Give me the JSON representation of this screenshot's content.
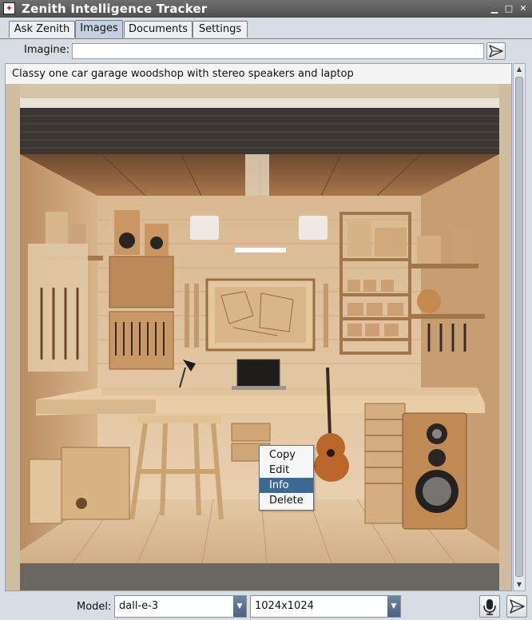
{
  "window": {
    "title": "Zenith Intelligence Tracker",
    "controls": [
      "minimize-icon",
      "maximize-icon",
      "close-icon"
    ]
  },
  "tabs": [
    {
      "label": "Ask Zenith",
      "active": false
    },
    {
      "label": "Images",
      "active": true
    },
    {
      "label": "Documents",
      "active": false
    },
    {
      "label": "Settings",
      "active": false
    }
  ],
  "imagine": {
    "label": "Imagine:",
    "value": "",
    "placeholder": ""
  },
  "content": {
    "prompt": "Classy one car garage woodshop with stereo speakers and laptop",
    "image_icon": "generated-woodshop-image"
  },
  "context_menu": {
    "items": [
      "Copy",
      "Edit",
      "Info",
      "Delete"
    ],
    "selected": "Info"
  },
  "bottom": {
    "model_label": "Model:",
    "model": "dall-e-3",
    "size": "1024x1024"
  },
  "colors": {
    "accent": "#3d6a92",
    "titlebar": "#5a5a5a",
    "background": "#d8dde4"
  }
}
